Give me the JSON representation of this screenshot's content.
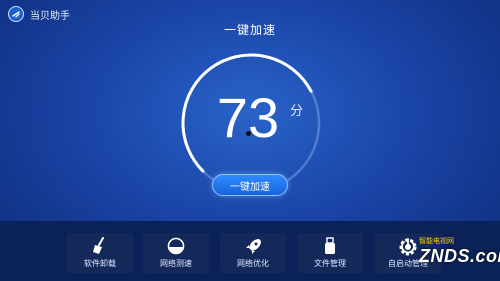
{
  "app": {
    "title": "当贝助手",
    "logo_icon": "dangbei-logo-icon"
  },
  "page": {
    "title": "一键加速"
  },
  "gauge": {
    "score": "73",
    "unit": "分",
    "level": 0.73
  },
  "action": {
    "label": "一键加速"
  },
  "tools": [
    {
      "label": "软件卸载",
      "icon": "broom-icon"
    },
    {
      "label": "网络测速",
      "icon": "speed-dial-icon"
    },
    {
      "label": "网络优化",
      "icon": "rocket-icon"
    },
    {
      "label": "文件管理",
      "icon": "usb-drive-icon"
    },
    {
      "label": "自启动管理",
      "icon": "power-icon"
    }
  ],
  "watermark": {
    "brand": "ZNDS.com",
    "tagline": "智能电视网"
  },
  "colors": {
    "background": "#1a45a8",
    "accent": "#2f8bff",
    "bar": "#0b2258"
  }
}
